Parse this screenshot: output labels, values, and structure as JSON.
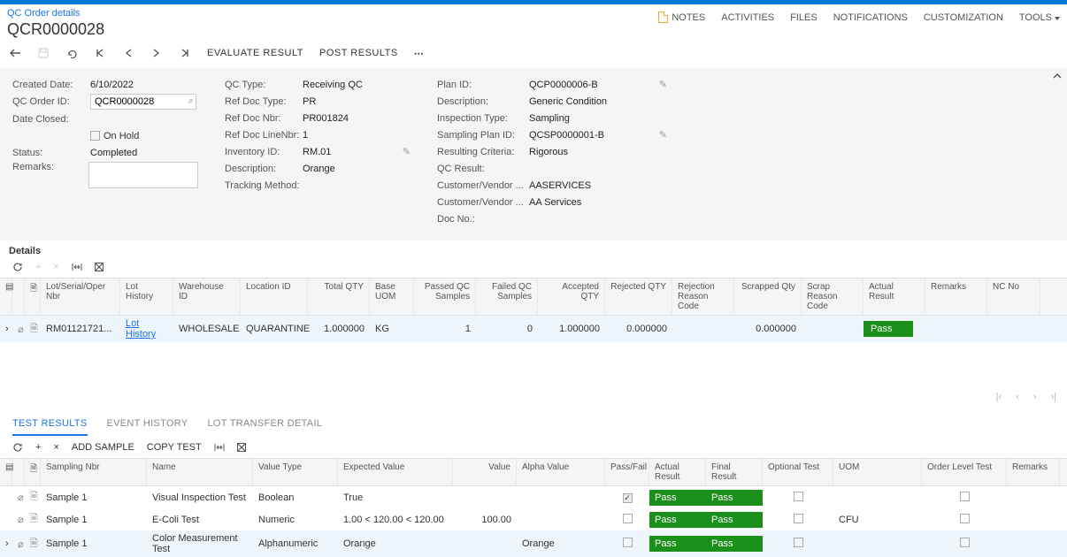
{
  "breadcrumb": "QC Order details",
  "title": "QCR0000028",
  "header_actions": {
    "notes": "NOTES",
    "activities": "ACTIVITIES",
    "files": "FILES",
    "notifications": "NOTIFICATIONS",
    "customization": "CUSTOMIZATION",
    "tools": "TOOLS"
  },
  "toolbar": {
    "evaluate": "EVALUATE RESULT",
    "post": "POST RESULTS"
  },
  "form": {
    "col1": {
      "created_date_label": "Created Date:",
      "created_date_value": "6/10/2022",
      "qc_order_id_label": "QC Order ID:",
      "qc_order_id_value": "QCR0000028",
      "date_closed_label": "Date Closed:",
      "date_closed_value": "",
      "on_hold_label": "On Hold",
      "status_label": "Status:",
      "status_value": "Completed",
      "remarks_label": "Remarks:"
    },
    "col2": {
      "qc_type_label": "QC Type:",
      "qc_type_value": "Receiving QC",
      "ref_doc_type_label": "Ref Doc Type:",
      "ref_doc_type_value": "PR",
      "ref_doc_nbr_label": "Ref Doc Nbr:",
      "ref_doc_nbr_value": "PR001824",
      "ref_doc_line_label": "Ref Doc LineNbr:",
      "ref_doc_line_value": "1",
      "inventory_id_label": "Inventory ID:",
      "inventory_id_value": "RM.01",
      "description_label": "Description:",
      "description_value": "Orange",
      "tracking_label": "Tracking Method:",
      "tracking_value": ""
    },
    "col3": {
      "plan_id_label": "Plan ID:",
      "plan_id_value": "QCP0000006-B",
      "description_label": "Description:",
      "description_value": "Generic Condition",
      "inspection_type_label": "Inspection Type:",
      "inspection_type_value": "Sampling",
      "sampling_plan_label": "Sampling Plan ID:",
      "sampling_plan_value": "QCSP0000001-B",
      "resulting_criteria_label": "Resulting Criteria:",
      "resulting_criteria_value": "Rigorous",
      "qc_result_label": "QC Result:",
      "qc_result_value": "",
      "cust_vendor_label": "Customer/Vendor ...",
      "cust_vendor_value": "AASERVICES",
      "cust_vendor_name_label": "Customer/Vendor ...",
      "cust_vendor_name_value": "AA Services",
      "doc_no_label": "Doc No.:",
      "doc_no_value": ""
    }
  },
  "details_title": "Details",
  "details_grid": {
    "headers": {
      "lot": "Lot/Serial/Oper Nbr",
      "history": "Lot History",
      "warehouse": "Warehouse ID",
      "location": "Location ID",
      "total_qty": "Total QTY",
      "base_uom": "Base UOM",
      "passed": "Passed QC Samples",
      "failed": "Failed QC Samples",
      "accepted": "Accepted QTY",
      "rejected": "Rejected QTY",
      "rej_reason": "Rejection Reason Code",
      "scrapped": "Scrapped Qty",
      "scrap_reason": "Scrap Reason Code",
      "actual": "Actual Result",
      "remarks": "Remarks",
      "nc": "NC No"
    },
    "row": {
      "lot": "RM01121721...",
      "history": "Lot History",
      "warehouse": "WHOLESALE",
      "location": "QUARANTINE",
      "total_qty": "1.000000",
      "base_uom": "KG",
      "passed": "1",
      "failed": "0",
      "accepted": "1.000000",
      "rejected": "0.000000",
      "rej_reason": "",
      "scrapped": "0.000000",
      "scrap_reason": "",
      "actual": "Pass",
      "remarks": "",
      "nc": ""
    }
  },
  "tabs": {
    "test_results": "TEST RESULTS",
    "event_history": "EVENT HISTORY",
    "lot_transfer": "LOT TRANSFER DETAIL"
  },
  "sub_toolbar": {
    "add_sample": "ADD SAMPLE",
    "copy_test": "COPY TEST"
  },
  "tests_grid": {
    "headers": {
      "sampling_nbr": "Sampling Nbr",
      "name": "Name",
      "value_type": "Value Type",
      "expected": "Expected Value",
      "value": "Value",
      "alpha": "Alpha Value",
      "passfail": "Pass/Fail",
      "actual": "Actual Result",
      "final": "Final Result",
      "optional": "Optional Test",
      "uom": "UOM",
      "order_level": "Order Level Test",
      "remarks": "Remarks"
    },
    "rows": [
      {
        "sampling_nbr": "Sample 1",
        "name": "Visual Inspection Test",
        "value_type": "Boolean",
        "expected": "True",
        "value": "",
        "alpha": "",
        "passfail_checked": true,
        "actual": "Pass",
        "final": "Pass",
        "optional_checked": false,
        "uom": "",
        "order_level_checked": false
      },
      {
        "sampling_nbr": "Sample 1",
        "name": "E-Coli Test",
        "value_type": "Numeric",
        "expected": "1.00 < 120.00 < 120.00",
        "value": "100.00",
        "alpha": "",
        "passfail_checked": false,
        "actual": "Pass",
        "final": "Pass",
        "optional_checked": false,
        "uom": "CFU",
        "order_level_checked": false
      },
      {
        "sampling_nbr": "Sample 1",
        "name": "Color Measurement Test",
        "value_type": "Alphanumeric",
        "expected": "Orange",
        "value": "",
        "alpha": "Orange",
        "passfail_checked": false,
        "actual": "Pass",
        "final": "Pass",
        "optional_checked": false,
        "uom": "",
        "order_level_checked": false
      }
    ]
  }
}
